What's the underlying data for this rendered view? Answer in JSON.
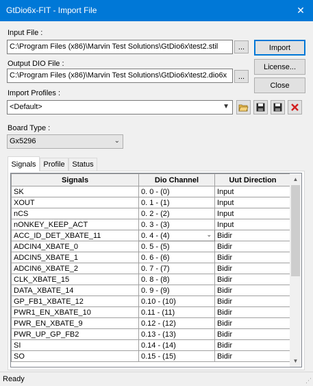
{
  "window": {
    "title": "GtDio6x-FIT - Import File"
  },
  "input_file": {
    "label": "Input File :",
    "value": "C:\\Program Files (x86)\\Marvin Test Solutions\\GtDio6x\\test2.stil",
    "browse_label": "..."
  },
  "output_file": {
    "label": "Output DIO File :",
    "value": "C:\\Program Files (x86)\\Marvin Test Solutions\\GtDio6x\\test2.dio6x",
    "browse_label": "..."
  },
  "buttons": {
    "import": "Import",
    "license": "License...",
    "close": "Close"
  },
  "import_profiles": {
    "label": "Import Profiles :",
    "selected": "<Default>"
  },
  "board_type": {
    "label": "Board Type :",
    "selected": "Gx5296"
  },
  "tabs": [
    {
      "label": "Signals"
    },
    {
      "label": "Profile"
    },
    {
      "label": "Status"
    }
  ],
  "table": {
    "headers": [
      "Signals",
      "Dio Channel",
      "Uut Direction"
    ],
    "rows": [
      {
        "signal": "SK",
        "channel": "0. 0 - (0)",
        "direction": "Input"
      },
      {
        "signal": "XOUT",
        "channel": "0. 1 - (1)",
        "direction": "Input"
      },
      {
        "signal": "nCS",
        "channel": "0. 2 - (2)",
        "direction": "Input"
      },
      {
        "signal": "nONKEY_KEEP_ACT",
        "channel": "0. 3 - (3)",
        "direction": "Input"
      },
      {
        "signal": "ACC_ID_DET_XBATE_11",
        "channel": "0. 4 - (4)",
        "direction": "Bidir"
      },
      {
        "signal": "ADCIN4_XBATE_0",
        "channel": "0. 5 - (5)",
        "direction": "Bidir"
      },
      {
        "signal": "ADCIN5_XBATE_1",
        "channel": "0. 6 - (6)",
        "direction": "Bidir"
      },
      {
        "signal": "ADCIN6_XBATE_2",
        "channel": "0. 7 - (7)",
        "direction": "Bidir"
      },
      {
        "signal": "CLK_XBATE_15",
        "channel": "0. 8 - (8)",
        "direction": "Bidir"
      },
      {
        "signal": "DATA_XBATE_14",
        "channel": "0. 9 - (9)",
        "direction": "Bidir"
      },
      {
        "signal": "GP_FB1_XBATE_12",
        "channel": "0.10 - (10)",
        "direction": "Bidir"
      },
      {
        "signal": "PWR1_EN_XBATE_10",
        "channel": "0.11 - (11)",
        "direction": "Bidir"
      },
      {
        "signal": "PWR_EN_XBATE_9",
        "channel": "0.12 - (12)",
        "direction": "Bidir"
      },
      {
        "signal": "PWR_UP_GP_FB2",
        "channel": "0.13 - (13)",
        "direction": "Bidir"
      },
      {
        "signal": "SI",
        "channel": "0.14 - (14)",
        "direction": "Bidir"
      },
      {
        "signal": "SO",
        "channel": "0.15 - (15)",
        "direction": "Bidir"
      }
    ]
  },
  "status": {
    "text": "Ready"
  }
}
